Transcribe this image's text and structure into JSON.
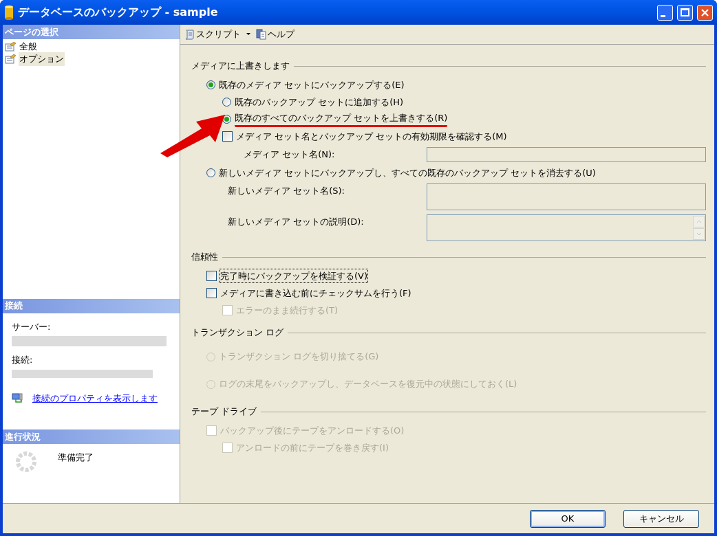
{
  "window": {
    "title": "データベースのバックアップ - sample"
  },
  "sidebar": {
    "page_selection": {
      "header": "ページの選択",
      "items": [
        {
          "label": "全般",
          "selected": false
        },
        {
          "label": "オプション",
          "selected": true
        }
      ]
    },
    "connection": {
      "header": "接続",
      "server_label": "サーバー:",
      "connection_label": "接続:",
      "link": "接続のプロパティを表示します"
    },
    "progress": {
      "header": "進行状況",
      "status": "準備完了"
    }
  },
  "toolbar": [
    {
      "label": "スクリプト",
      "kind": "script"
    },
    {
      "label": "ヘルプ",
      "kind": "help"
    }
  ],
  "sections": [
    {
      "title": "メディアに上書きします",
      "controls": [
        {
          "kind": "radio",
          "label": "既存のメディア セットにバックアップする(E)",
          "selected": true,
          "disabled": false,
          "children": [
            {
              "kind": "radio",
              "label": "既存のバックアップ セットに追加する(H)",
              "selected": false,
              "disabled": false
            },
            {
              "kind": "radio",
              "label": "既存のすべてのバックアップ セットを上書きする(R)",
              "selected": true,
              "disabled": false,
              "highlighted": true
            },
            {
              "kind": "checkbox",
              "label": "メディア セット名とバックアップ セットの有効期限を確認する(M)",
              "checked": false,
              "disabled": false,
              "children": [
                {
                  "kind": "field",
                  "label": "メディア セット名(N):"
                }
              ]
            }
          ]
        },
        {
          "kind": "radio",
          "label": "新しいメディア セットにバックアップし、すべての既存のバックアップ セットを消去する(U)",
          "selected": false,
          "disabled": false,
          "children": [
            {
              "kind": "field",
              "label": "新しいメディア セット名(S):",
              "multiline": true
            },
            {
              "kind": "textarea",
              "label": "新しいメディア セットの説明(D):"
            }
          ]
        }
      ]
    },
    {
      "title": "信頼性",
      "controls": [
        {
          "kind": "checkbox",
          "label": "完了時にバックアップを検証する(V)",
          "checked": false,
          "disabled": false,
          "focused": true
        },
        {
          "kind": "checkbox",
          "label": "メディアに書き込む前にチェックサムを行う(F)",
          "checked": false,
          "disabled": false,
          "children": [
            {
              "kind": "checkbox",
              "label": "エラーのまま続行する(T)",
              "checked": false,
              "disabled": true
            }
          ]
        }
      ]
    },
    {
      "title": "トランザクション ログ",
      "controls": [
        {
          "kind": "radio",
          "label": "トランザクション ログを切り捨てる(G)",
          "selected": false,
          "disabled": true
        },
        {
          "kind": "radio",
          "label": "ログの末尾をバックアップし、データベースを復元中の状態にしておく(L)",
          "selected": false,
          "disabled": true
        }
      ]
    },
    {
      "title": "テープ ドライブ",
      "controls": [
        {
          "kind": "checkbox",
          "label": "バックアップ後にテープをアンロードする(O)",
          "checked": false,
          "disabled": true,
          "children": [
            {
              "kind": "checkbox",
              "label": "アンロードの前にテープを巻き戻す(I)",
              "checked": false,
              "disabled": true
            }
          ]
        }
      ]
    }
  ],
  "buttons": [
    {
      "label": "OK",
      "default": true
    },
    {
      "label": "キャンセル",
      "default": false
    }
  ]
}
